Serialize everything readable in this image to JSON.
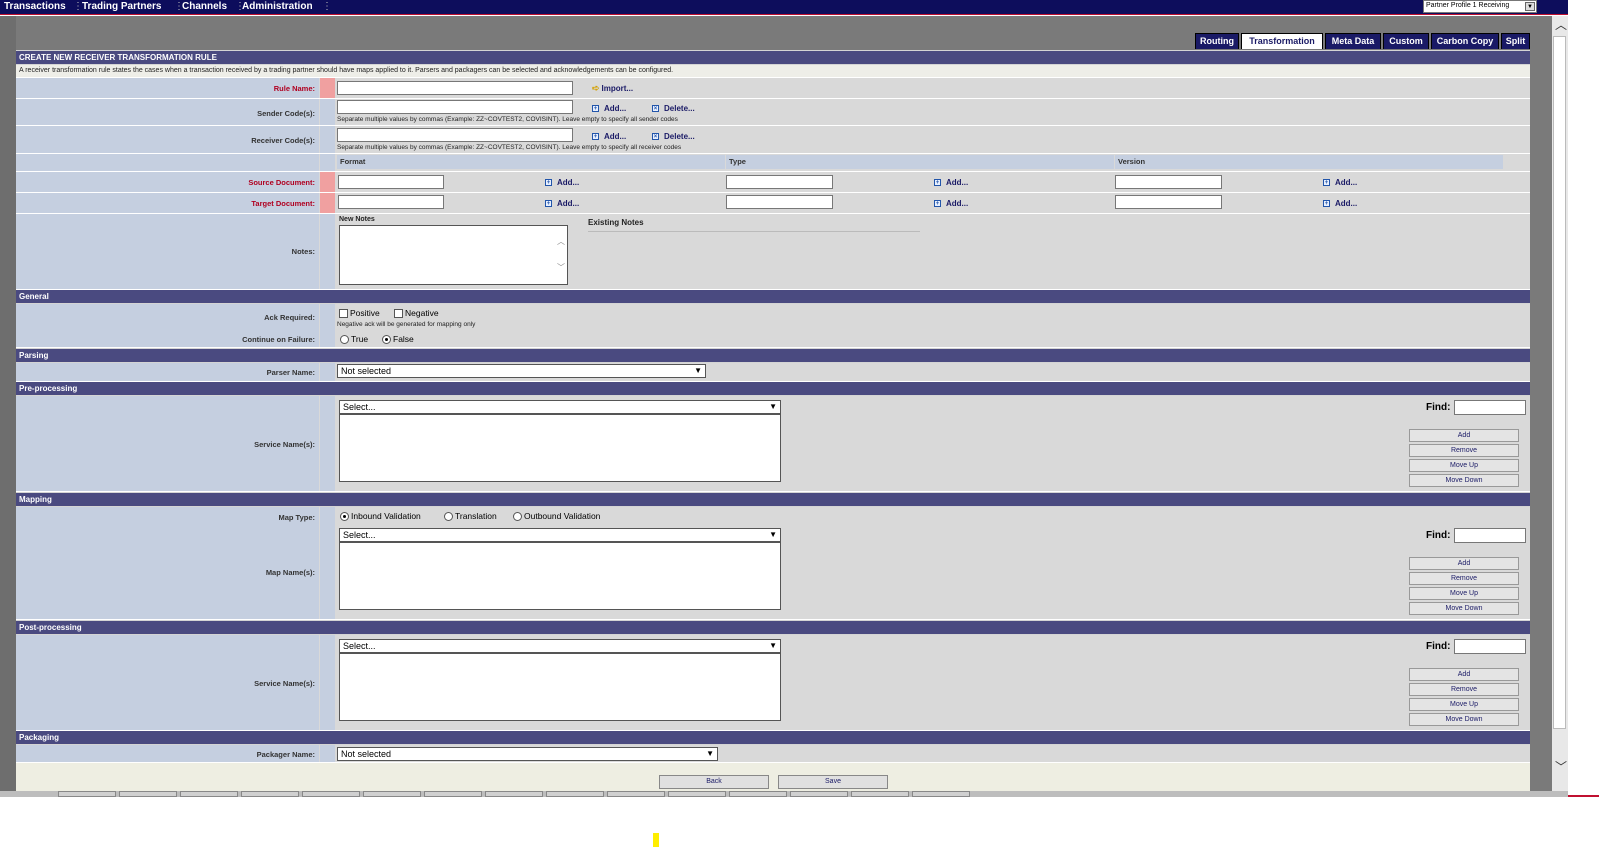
{
  "nav": {
    "items": [
      "Transactions",
      "Trading Partners",
      "Channels",
      "Administration"
    ],
    "profile": "Partner Profile 1 Receiving"
  },
  "tabs": [
    "Routing",
    "Transformation",
    "Meta Data",
    "Custom",
    "Carbon Copy",
    "Split"
  ],
  "active_tab": "Transformation",
  "section_title": "CREATE NEW RECEIVER TRANSFORMATION RULE",
  "description": "A receiver transformation rule states the cases when a transaction received by a trading partner should have maps applied to it. Parsers and packagers can be selected and acknowledgements can be configured.",
  "rule": {
    "rule_name_label": "Rule Name:",
    "import_link": "Import...",
    "sender_label": "Sender Code(s):",
    "receiver_label": "Receiver Code(s):",
    "add_link": "Add...",
    "delete_link": "Delete...",
    "sender_hint": "Separate multiple values by commas (Example: ZZ~COVTEST2, COVISINT). Leave empty to specify all sender codes",
    "receiver_hint": "Separate multiple values by commas (Example: ZZ~COVTEST2, COVISINT). Leave empty to specify all receiver codes"
  },
  "doc_table": {
    "columns": [
      "Format",
      "Type",
      "Version"
    ],
    "source_label": "Source Document:",
    "target_label": "Target Document:"
  },
  "notes": {
    "label": "Notes:",
    "new_notes": "New Notes",
    "existing_notes": "Existing Notes"
  },
  "general": {
    "header": "General",
    "ack_label": "Ack Required:",
    "positive": "Positive",
    "negative": "Negative",
    "ack_hint": "Negative ack will be generated for mapping only",
    "continue_label": "Continue on Failure:",
    "true_label": "True",
    "false_label": "False"
  },
  "parsing": {
    "header": "Parsing",
    "parser_label": "Parser Name:",
    "parser_value": "Not selected"
  },
  "preprocessing": {
    "header": "Pre-processing",
    "service_label": "Service Name(s):",
    "select_value": "Select..."
  },
  "mapping": {
    "header": "Mapping",
    "map_type_label": "Map Type:",
    "inbound": "Inbound Validation",
    "translation": "Translation",
    "outbound": "Outbound Validation",
    "map_name_label": "Map Name(s):",
    "select_value": "Select..."
  },
  "postprocessing": {
    "header": "Post-processing",
    "service_label": "Service Name(s):",
    "select_value": "Select..."
  },
  "packaging": {
    "header": "Packaging",
    "packager_label": "Packager Name:",
    "packager_value": "Not selected"
  },
  "list_buttons": {
    "find": "Find:",
    "add": "Add",
    "remove": "Remove",
    "move_up": "Move Up",
    "move_down": "Move Down"
  },
  "footer": {
    "back": "Back",
    "save": "Save"
  }
}
